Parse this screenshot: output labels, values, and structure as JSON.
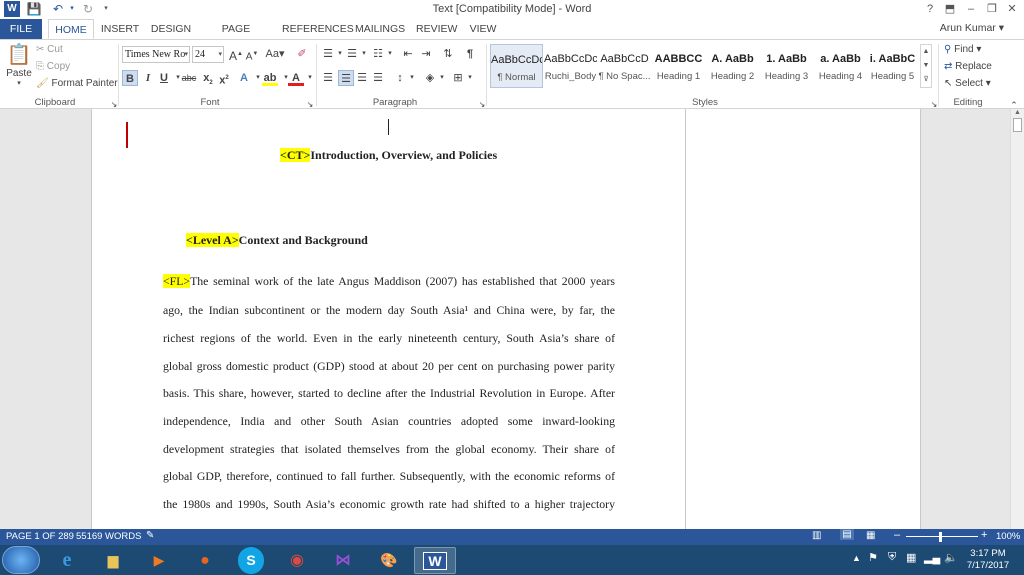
{
  "titlebar": {
    "title": "Text [Compatibility Mode] - Word",
    "help": "?",
    "minimize": "–",
    "restore": "❐",
    "close": "✕",
    "ribbon_display": "⬒"
  },
  "tabs": {
    "file": "FILE",
    "items": [
      "HOME",
      "INSERT",
      "DESIGN",
      "PAGE LAYOUT",
      "REFERENCES",
      "MAILINGS",
      "REVIEW",
      "VIEW"
    ],
    "user": "Arun Kumar"
  },
  "clipboard": {
    "paste": "Paste",
    "cut": "Cut",
    "copy": "Copy",
    "format_painter": "Format Painter",
    "label": "Clipboard"
  },
  "font": {
    "name": "Times New Ro",
    "size": "24",
    "label": "Font"
  },
  "paragraph": {
    "label": "Paragraph"
  },
  "styles": {
    "label": "Styles",
    "items": [
      {
        "preview": "AaBbCcDc",
        "name": "¶ Normal"
      },
      {
        "preview": "AaBbCcDc",
        "name": "Ruchi_Body"
      },
      {
        "preview": "AaBbCcD",
        "name": "¶ No Spac..."
      },
      {
        "preview": "AABBCC",
        "name": "Heading 1"
      },
      {
        "preview": "A. AaBb",
        "name": "Heading 2"
      },
      {
        "preview": "1. AaBb",
        "name": "Heading 3"
      },
      {
        "preview": "a. AaBb",
        "name": "Heading 4"
      },
      {
        "preview": "i. AaBbC",
        "name": "Heading 5"
      }
    ]
  },
  "editing": {
    "find": "Find",
    "replace": "Replace",
    "select": "Select",
    "label": "Editing"
  },
  "document": {
    "chapter_tag": "<CT>",
    "chapter_title": "Introduction, Overview, and Policies",
    "level_tag": "<Level A>",
    "level_title": "Context and Background",
    "fl_tag": "<FL>",
    "lines": [
      "The seminal work of the late Angus Maddison (2007) has established that 2000 years",
      "ago, the Indian subcontinent or the modern day South Asia¹ and China were, by far, the",
      "richest regions of the world. Even in the early nineteenth century, South Asia’s share of",
      "global gross domestic product (GDP) stood at about 20 per cent on purchasing power parity",
      "basis. This share, however, started to decline after the Industrial Revolution in Europe. After",
      "independence, India and other South Asian countries adopted some inward-looking",
      "development strategies that isolated themselves from the global economy. Their share of",
      "global GDP, therefore, continued to fall further. Subsequently, with the economic reforms of",
      "the 1980s and 1990s, South Asia’s economic growth rate had shifted to a higher trajectory"
    ]
  },
  "status": {
    "page": "PAGE 1 OF 289",
    "words": "55169 WORDS",
    "zoom": "100%"
  },
  "taskbar": {
    "time": "3:17 PM",
    "date": "7/17/2017"
  },
  "colors": {
    "accent": "#2b579a",
    "highlight": "#ffff00",
    "taskbar": "#1c4a73"
  }
}
